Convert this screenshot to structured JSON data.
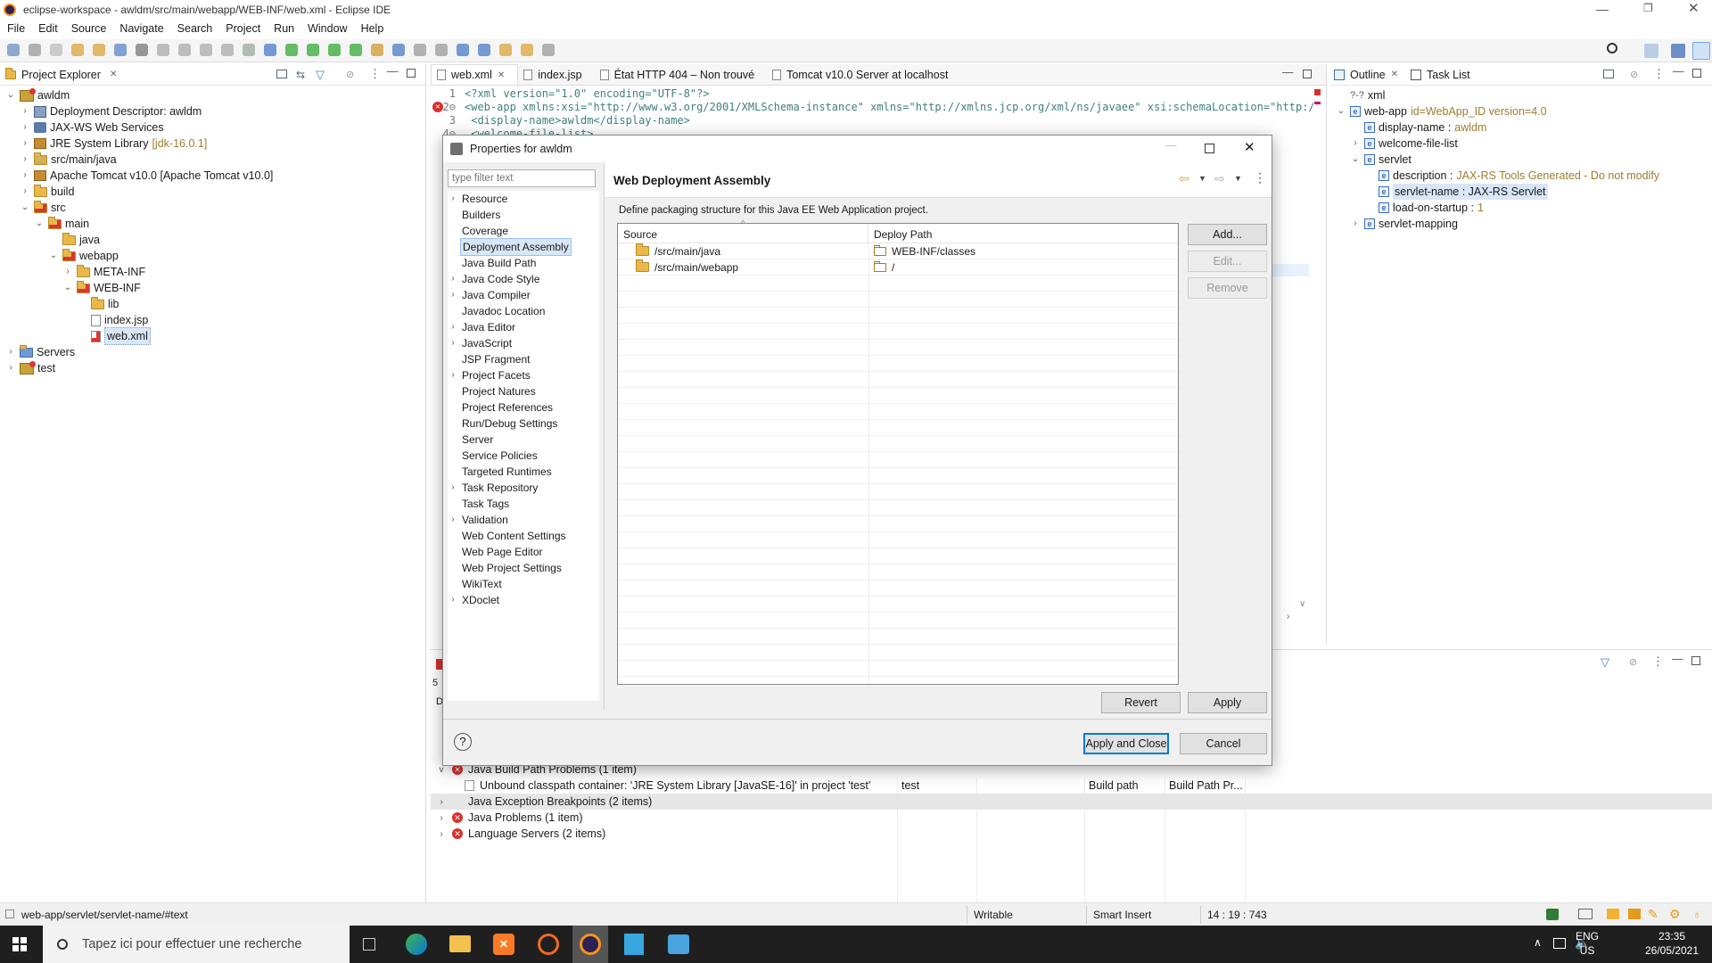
{
  "window": {
    "title": "eclipse-workspace - awldm/src/main/webapp/WEB-INF/web.xml - Eclipse IDE"
  },
  "menu": [
    "File",
    "Edit",
    "Source",
    "Navigate",
    "Search",
    "Project",
    "Run",
    "Window",
    "Help"
  ],
  "project_explorer": {
    "title": "Project Explorer",
    "items": [
      {
        "label": "awldm",
        "depth": 0,
        "arrow": "v",
        "kind": "proj"
      },
      {
        "label": "Deployment Descriptor: awldm",
        "depth": 1,
        "arrow": ">",
        "kind": "dd"
      },
      {
        "label": "JAX-WS Web Services",
        "depth": 1,
        "arrow": ">",
        "kind": "ws"
      },
      {
        "label": "JRE System Library",
        "suffix": "[jdk-16.0.1]",
        "depth": 1,
        "arrow": ">",
        "kind": "lib"
      },
      {
        "label": "src/main/java",
        "depth": 1,
        "arrow": ">",
        "kind": "pkg"
      },
      {
        "label": "Apache Tomcat v10.0 [Apache Tomcat v10.0]",
        "depth": 1,
        "arrow": ">",
        "kind": "lib"
      },
      {
        "label": "build",
        "depth": 1,
        "arrow": ">",
        "kind": "folder"
      },
      {
        "label": "src",
        "depth": 1,
        "arrow": "v",
        "kind": "folder-err"
      },
      {
        "label": "main",
        "depth": 2,
        "arrow": "v",
        "kind": "folder-err"
      },
      {
        "label": "java",
        "depth": 3,
        "arrow": "",
        "kind": "folder"
      },
      {
        "label": "webapp",
        "depth": 3,
        "arrow": "v",
        "kind": "folder-err"
      },
      {
        "label": "META-INF",
        "depth": 4,
        "arrow": ">",
        "kind": "folder"
      },
      {
        "label": "WEB-INF",
        "depth": 4,
        "arrow": "v",
        "kind": "folder-err"
      },
      {
        "label": "lib",
        "depth": 5,
        "arrow": "",
        "kind": "folder"
      },
      {
        "label": "index.jsp",
        "depth": 5,
        "arrow": "",
        "kind": "file"
      },
      {
        "label": "web.xml",
        "depth": 5,
        "arrow": "",
        "kind": "xml",
        "selected": true
      },
      {
        "label": "Servers",
        "depth": 0,
        "arrow": ">",
        "kind": "servers"
      },
      {
        "label": "test",
        "depth": 0,
        "arrow": ">",
        "kind": "proj"
      }
    ]
  },
  "editor_tabs": [
    {
      "label": "web.xml",
      "active": true,
      "close": "✕"
    },
    {
      "label": "index.jsp",
      "active": false
    },
    {
      "label": "État HTTP 404 – Non trouvé",
      "active": false
    },
    {
      "label": "Tomcat v10.0 Server at localhost",
      "active": false
    }
  ],
  "editor_lines": [
    {
      "num": "1",
      "text": "<?xml version=\"1.0\" encoding=\"UTF-8\"?>"
    },
    {
      "num": "2⊖",
      "text": "<web-app xmlns:xsi=\"http://www.w3.org/2001/XMLSchema-instance\" xmlns=\"http://xmlns.jcp.org/xml/ns/javaee\" xsi:schemaLocation=\"http://"
    },
    {
      "num": "3",
      "text": "  <display-name>awldm</display-name>"
    },
    {
      "num": "4⊖",
      "text": "  <welcome-file-list>"
    }
  ],
  "outline": {
    "tabs": [
      "Outline",
      "Task List"
    ],
    "items": [
      {
        "label": "xml",
        "prefix": "?-?",
        "depth": 0,
        "arrow": ""
      },
      {
        "label": "web-app",
        "attr": "id=WebApp_ID version=4.0",
        "depth": 0,
        "arrow": "v"
      },
      {
        "label": "display-name :",
        "attr": "awldm",
        "depth": 1,
        "arrow": ""
      },
      {
        "label": "welcome-file-list",
        "attr": "",
        "depth": 1,
        "arrow": ">"
      },
      {
        "label": "servlet",
        "attr": "",
        "depth": 1,
        "arrow": "v"
      },
      {
        "label": "description :",
        "attr": "JAX-RS Tools Generated - Do not modify",
        "depth": 2,
        "arrow": ""
      },
      {
        "label": "servlet-name : JAX-RS Servlet",
        "attr": "",
        "depth": 2,
        "arrow": "",
        "selected": true
      },
      {
        "label": "load-on-startup :",
        "attr": "1",
        "depth": 2,
        "arrow": ""
      },
      {
        "label": "servlet-mapping",
        "attr": "",
        "depth": 1,
        "arrow": ">"
      }
    ]
  },
  "dialog": {
    "title": "Properties for awldm",
    "filter_placeholder": "type filter text",
    "page_title": "Web Deployment Assembly",
    "description": "Define packaging structure for this Java EE Web Application project.",
    "nav": [
      {
        "label": "Resource",
        "arrow": ">"
      },
      {
        "label": "Builders",
        "arrow": ""
      },
      {
        "label": "Coverage",
        "arrow": ""
      },
      {
        "label": "Deployment Assembly",
        "arrow": "",
        "selected": true
      },
      {
        "label": "Java Build Path",
        "arrow": ""
      },
      {
        "label": "Java Code Style",
        "arrow": ">"
      },
      {
        "label": "Java Compiler",
        "arrow": ">"
      },
      {
        "label": "Javadoc Location",
        "arrow": ""
      },
      {
        "label": "Java Editor",
        "arrow": ">"
      },
      {
        "label": "JavaScript",
        "arrow": ">"
      },
      {
        "label": "JSP Fragment",
        "arrow": ""
      },
      {
        "label": "Project Facets",
        "arrow": ">"
      },
      {
        "label": "Project Natures",
        "arrow": ""
      },
      {
        "label": "Project References",
        "arrow": ""
      },
      {
        "label": "Run/Debug Settings",
        "arrow": ""
      },
      {
        "label": "Server",
        "arrow": ""
      },
      {
        "label": "Service Policies",
        "arrow": ""
      },
      {
        "label": "Targeted Runtimes",
        "arrow": ""
      },
      {
        "label": "Task Repository",
        "arrow": ">"
      },
      {
        "label": "Task Tags",
        "arrow": ""
      },
      {
        "label": "Validation",
        "arrow": ">"
      },
      {
        "label": "Web Content Settings",
        "arrow": ""
      },
      {
        "label": "Web Page Editor",
        "arrow": ""
      },
      {
        "label": "Web Project Settings",
        "arrow": ""
      },
      {
        "label": "WikiText",
        "arrow": ""
      },
      {
        "label": "XDoclet",
        "arrow": ">"
      }
    ],
    "table": {
      "headers": [
        "Source",
        "Deploy Path"
      ],
      "rows": [
        {
          "source": "/src/main/java",
          "deploy": "WEB-INF/classes"
        },
        {
          "source": "/src/main/webapp",
          "deploy": "/"
        }
      ]
    },
    "buttons": {
      "add": "Add...",
      "edit": "Edit...",
      "remove": "Remove",
      "revert": "Revert",
      "apply": "Apply",
      "apply_close": "Apply and Close",
      "cancel": "Cancel",
      "help": "?"
    }
  },
  "problems": {
    "row_group1": "Java Build Path Problems (1 item)",
    "row_detail": "Unbound classpath container: 'JRE System Library [JavaSE-16]' in project 'test'",
    "row_detail_resource": "test",
    "row_detail_location": "Build path",
    "row_detail_type": "Build Path Pr...",
    "groups": [
      {
        "label": "Java Exception Breakpoints (2 items)",
        "err": false,
        "selected": true
      },
      {
        "label": "Java Problems (1 item)",
        "err": true
      },
      {
        "label": "Language Servers (2 items)",
        "err": true
      }
    ],
    "left_fragments": [
      "5",
      "D"
    ]
  },
  "status_bar": {
    "path": "web-app/servlet/servlet-name/#text",
    "mode": "Writable",
    "insert": "Smart Insert",
    "pos": "14 : 19 : 743"
  },
  "taskbar": {
    "search": "Tapez ici pour effectuer une recherche",
    "lang": "ENG",
    "region": "US",
    "time": "23:35",
    "date": "26/05/2021",
    "notif": "2"
  }
}
